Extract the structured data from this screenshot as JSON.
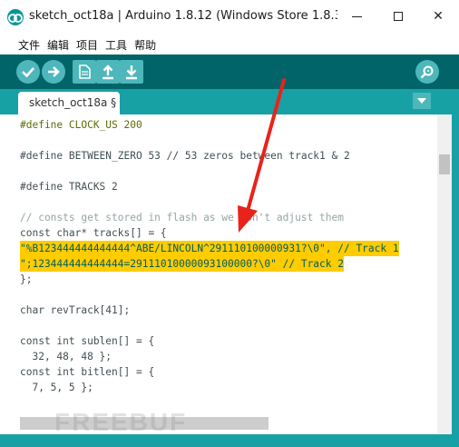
{
  "window": {
    "title": "sketch_oct18a | Arduino 1.8.12 (Windows Store 1.8.3...",
    "minimize_label": "",
    "maximize_label": "",
    "close_label": "✕"
  },
  "menu": [
    "文件",
    "编辑",
    "项目",
    "工具",
    "帮助"
  ],
  "toolbar": {
    "buttons": [
      {
        "name": "verify",
        "icon": "check-icon"
      },
      {
        "name": "upload",
        "icon": "arrow-right-icon"
      },
      {
        "name": "new",
        "icon": "new-file-icon"
      },
      {
        "name": "open",
        "icon": "arrow-up-icon"
      },
      {
        "name": "save",
        "icon": "arrow-down-icon"
      },
      {
        "name": "serial-monitor",
        "icon": "magnifier-icon"
      }
    ]
  },
  "tab": {
    "label": "sketch_oct18a §"
  },
  "code": {
    "line1": "#define CLOCK_US 200",
    "line2": "#define BETWEEN_ZERO 53 // 53 zeros between track1 & 2",
    "line3": "#define TRACKS 2",
    "line4": "// consts get stored in flash as we don't adjust them",
    "line5": "const char* tracks[] = {",
    "line6": "\"%B123444444444444^ABE/LINCOLN^291110100000931?\\0\", // Track 1",
    "line7": "\";123444444444444=29111010000093100000?\\0\" // Track 2",
    "line8": "};",
    "line9": "char revTrack[41];",
    "line10": "const int sublen[] = {",
    "line11": "  32, 48, 48 };",
    "line12": "const int bitlen[] = {",
    "line13": "  7, 5, 5 };"
  },
  "watermark": "FREEBUF",
  "colors": {
    "toolbar": "#006468",
    "tabstrip": "#17a1a5",
    "highlight": "#ffcc00",
    "arrow": "#e8231b"
  }
}
